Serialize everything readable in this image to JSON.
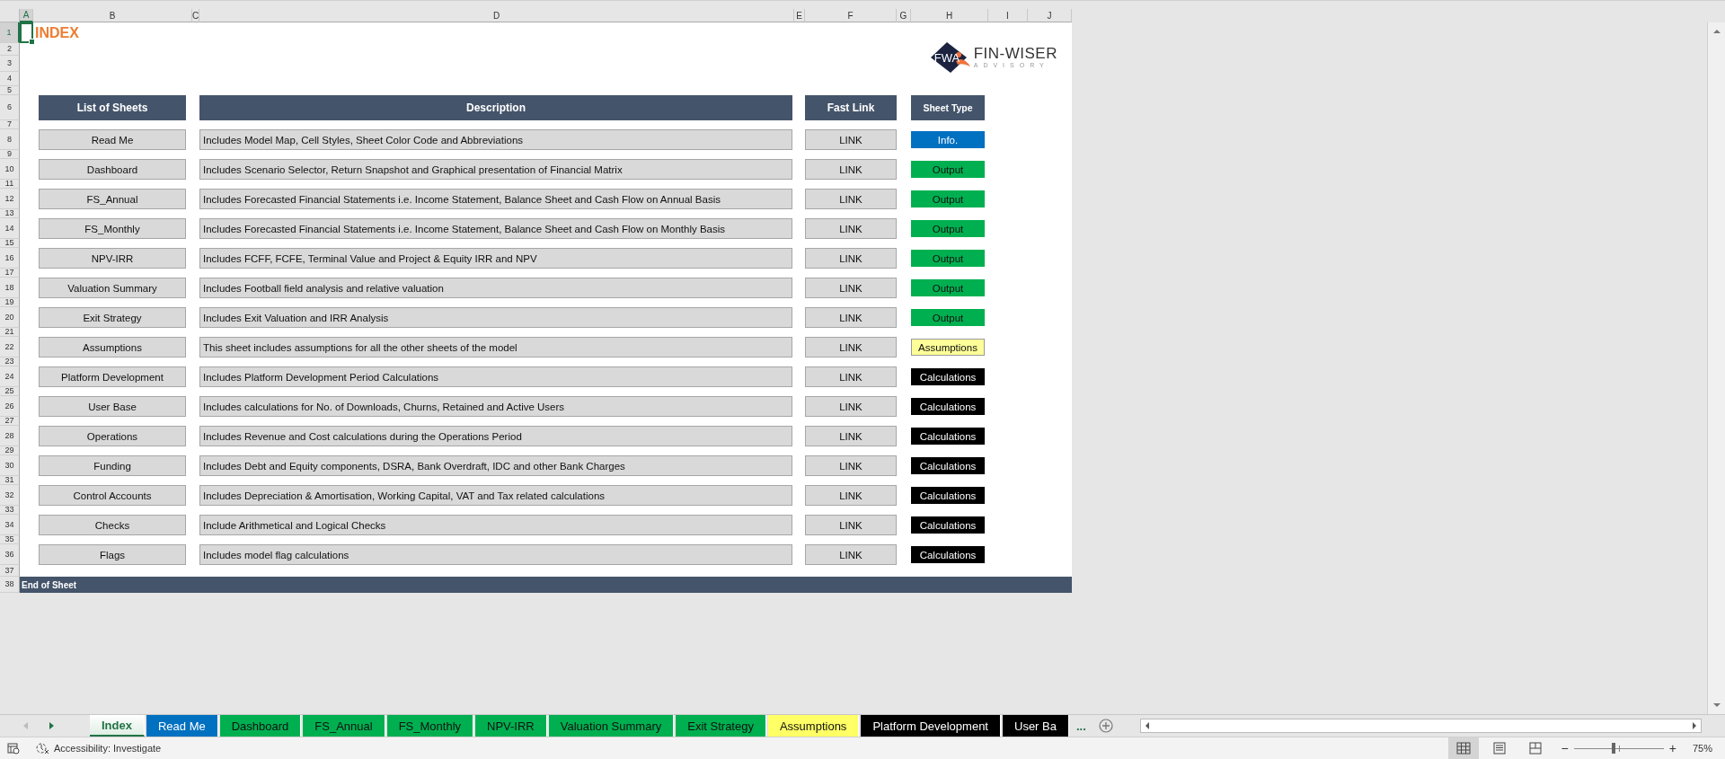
{
  "sheet": {
    "title": "INDEX",
    "columns": [
      {
        "label": "A",
        "selected": true
      },
      {
        "label": "B",
        "selected": false
      },
      {
        "label": "C",
        "selected": false
      },
      {
        "label": "D",
        "selected": false
      },
      {
        "label": "E",
        "selected": false
      },
      {
        "label": "F",
        "selected": false
      },
      {
        "label": "G",
        "selected": false
      },
      {
        "label": "H",
        "selected": false
      },
      {
        "label": "I",
        "selected": false
      },
      {
        "label": "J",
        "selected": false
      }
    ],
    "row_numbers": [
      {
        "label": "1",
        "selected": true
      },
      {
        "label": "2",
        "selected": false
      },
      {
        "label": "3",
        "selected": false
      },
      {
        "label": "4",
        "selected": false
      },
      {
        "label": "5",
        "selected": false
      },
      {
        "label": "6",
        "selected": false
      },
      {
        "label": "7",
        "selected": false
      },
      {
        "label": "8",
        "selected": false
      },
      {
        "label": "9",
        "selected": false
      },
      {
        "label": "10",
        "selected": false
      },
      {
        "label": "11",
        "selected": false
      },
      {
        "label": "12",
        "selected": false
      },
      {
        "label": "13",
        "selected": false
      },
      {
        "label": "14",
        "selected": false
      },
      {
        "label": "15",
        "selected": false
      },
      {
        "label": "16",
        "selected": false
      },
      {
        "label": "17",
        "selected": false
      },
      {
        "label": "18",
        "selected": false
      },
      {
        "label": "19",
        "selected": false
      },
      {
        "label": "20",
        "selected": false
      },
      {
        "label": "21",
        "selected": false
      },
      {
        "label": "22",
        "selected": false
      },
      {
        "label": "23",
        "selected": false
      },
      {
        "label": "24",
        "selected": false
      },
      {
        "label": "25",
        "selected": false
      },
      {
        "label": "26",
        "selected": false
      },
      {
        "label": "27",
        "selected": false
      },
      {
        "label": "28",
        "selected": false
      },
      {
        "label": "29",
        "selected": false
      },
      {
        "label": "30",
        "selected": false
      },
      {
        "label": "31",
        "selected": false
      },
      {
        "label": "32",
        "selected": false
      },
      {
        "label": "33",
        "selected": false
      },
      {
        "label": "34",
        "selected": false
      },
      {
        "label": "35",
        "selected": false
      },
      {
        "label": "36",
        "selected": false
      },
      {
        "label": "37",
        "selected": false
      },
      {
        "label": "38",
        "selected": false
      }
    ],
    "logo": {
      "mark": "FWA",
      "name": "FIN-WISER",
      "tagline": "ADVISORY"
    },
    "table": {
      "columns": [
        "List of Sheets",
        "Description",
        "Fast Link",
        "Sheet Type"
      ],
      "rows": [
        {
          "sheet": "Read Me",
          "description": "Includes Model Map, Cell Styles, Sheet Color Code and Abbreviations",
          "link": "LINK",
          "type": "Info.",
          "kind": "info"
        },
        {
          "sheet": "Dashboard",
          "description": "Includes Scenario Selector, Return Snapshot and Graphical presentation of Financial Matrix",
          "link": "LINK",
          "type": "Output",
          "kind": "output"
        },
        {
          "sheet": "FS_Annual",
          "description": "Includes Forecasted Financial Statements i.e. Income Statement, Balance Sheet and Cash Flow on Annual Basis",
          "link": "LINK",
          "type": "Output",
          "kind": "output"
        },
        {
          "sheet": "FS_Monthly",
          "description": "Includes Forecasted Financial Statements i.e. Income Statement, Balance Sheet and Cash Flow on Monthly Basis",
          "link": "LINK",
          "type": "Output",
          "kind": "output"
        },
        {
          "sheet": "NPV-IRR",
          "description": "Includes FCFF, FCFE, Terminal Value and Project & Equity IRR and NPV",
          "link": "LINK",
          "type": "Output",
          "kind": "output"
        },
        {
          "sheet": "Valuation Summary",
          "description": "Includes Football field analysis and relative valuation",
          "link": "LINK",
          "type": "Output",
          "kind": "output"
        },
        {
          "sheet": "Exit Strategy",
          "description": "Includes Exit Valuation and IRR Analysis",
          "link": "LINK",
          "type": "Output",
          "kind": "output"
        },
        {
          "sheet": "Assumptions",
          "description": "This sheet includes assumptions for all the other sheets of the model",
          "link": "LINK",
          "type": "Assumptions",
          "kind": "assumptions"
        },
        {
          "sheet": "Platform Development",
          "description": "Includes Platform Development Period Calculations",
          "link": "LINK",
          "type": "Calculations",
          "kind": "calculations"
        },
        {
          "sheet": "User Base",
          "description": "Includes calculations for No. of Downloads, Churns, Retained and Active Users",
          "link": "LINK",
          "type": "Calculations",
          "kind": "calculations"
        },
        {
          "sheet": "Operations",
          "description": "Includes Revenue and Cost calculations during the Operations Period",
          "link": "LINK",
          "type": "Calculations",
          "kind": "calculations"
        },
        {
          "sheet": "Funding",
          "description": "Includes Debt and Equity components, DSRA, Bank Overdraft, IDC and other Bank Charges",
          "link": "LINK",
          "type": "Calculations",
          "kind": "calculations"
        },
        {
          "sheet": "Control Accounts",
          "description": "Includes Depreciation & Amortisation, Working Capital, VAT and Tax related calculations",
          "link": "LINK",
          "type": "Calculations",
          "kind": "calculations"
        },
        {
          "sheet": "Checks",
          "description": "Include Arithmetical and Logical Checks",
          "link": "LINK",
          "type": "Calculations",
          "kind": "calculations"
        },
        {
          "sheet": "Flags",
          "description": "Includes model flag calculations",
          "link": "LINK",
          "type": "Calculations",
          "kind": "calculations"
        }
      ]
    },
    "footer": "End of Sheet"
  },
  "tabs": [
    {
      "label": "Index",
      "kind": "plain",
      "selected": true
    },
    {
      "label": "Read Me",
      "kind": "info",
      "selected": false
    },
    {
      "label": "Dashboard",
      "kind": "output",
      "selected": false
    },
    {
      "label": "FS_Annual",
      "kind": "output",
      "selected": false
    },
    {
      "label": "FS_Monthly",
      "kind": "output",
      "selected": false
    },
    {
      "label": "NPV-IRR",
      "kind": "output",
      "selected": false
    },
    {
      "label": "Valuation Summary",
      "kind": "output",
      "selected": false
    },
    {
      "label": "Exit Strategy",
      "kind": "output",
      "selected": false
    },
    {
      "label": "Assumptions",
      "kind": "assumptions",
      "selected": false
    },
    {
      "label": "Platform Development",
      "kind": "calculations",
      "selected": false
    },
    {
      "label": "User Ba",
      "kind": "calculations",
      "selected": false
    }
  ],
  "more_tabs": "...",
  "status_bar": {
    "accessibility": "Accessibility: Investigate",
    "zoom_out": "−",
    "zoom_in": "+",
    "zoom": {
      "level": 0.44,
      "reading": "75%"
    }
  }
}
